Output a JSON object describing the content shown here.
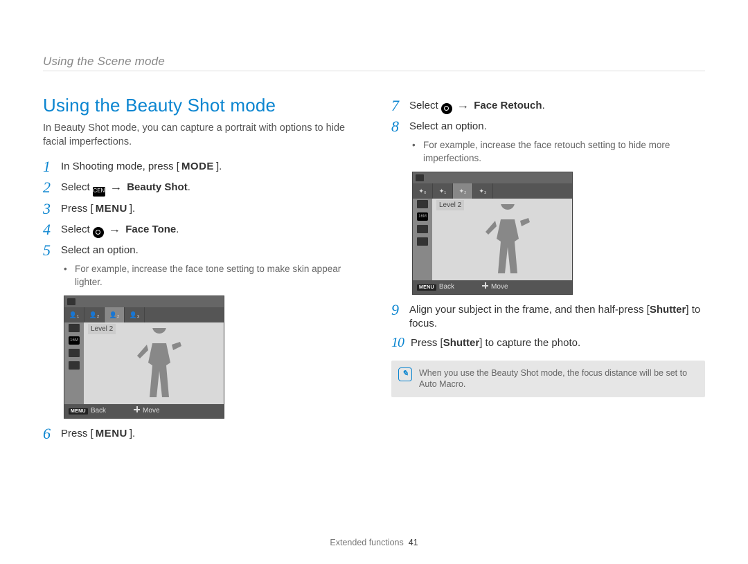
{
  "running_head": "Using the Scene mode",
  "section_title": "Using the Beauty Shot mode",
  "intro": "In Beauty Shot mode, you can capture a portrait with options to hide facial imperfections.",
  "steps": {
    "s1_pre": "In Shooting mode, press [",
    "s1_key": "MODE",
    "s1_post": "].",
    "s2_pre": "Select ",
    "s2_icon_name": "scene-icon",
    "s2_arrow": "→",
    "s2_bold": "Beauty Shot",
    "s2_post": ".",
    "s3_pre": "Press [",
    "s3_key": "MENU",
    "s3_post": "].",
    "s4_pre": "Select ",
    "s4_icon_name": "camera-icon",
    "s4_arrow": "→",
    "s4_bold": "Face Tone",
    "s4_post": ".",
    "s5": "Select an option.",
    "s5_sub": "For example, increase the face tone setting to make skin appear lighter.",
    "s6_pre": "Press [",
    "s6_key": "MENU",
    "s6_post": "].",
    "s7_pre": "Select ",
    "s7_icon_name": "camera-icon",
    "s7_arrow": "→",
    "s7_bold": "Face Retouch",
    "s7_post": ".",
    "s8": "Select an option.",
    "s8_sub": "For example, increase the face retouch setting to hide more imperfections.",
    "s9_pre": "Align your subject in the frame, and then half-press [",
    "s9_key": "Shutter",
    "s9_post": "] to focus.",
    "s10_pre": "Press [",
    "s10_key": "Shutter",
    "s10_post": "] to capture the photo."
  },
  "screenshot": {
    "level_label": "Level 2",
    "back_key": "MENU",
    "back_label": "Back",
    "move_label": "Move"
  },
  "note": {
    "text": "When you use the Beauty Shot mode, the focus distance will be set to Auto Macro."
  },
  "footer": {
    "section": "Extended functions",
    "page": "41"
  }
}
